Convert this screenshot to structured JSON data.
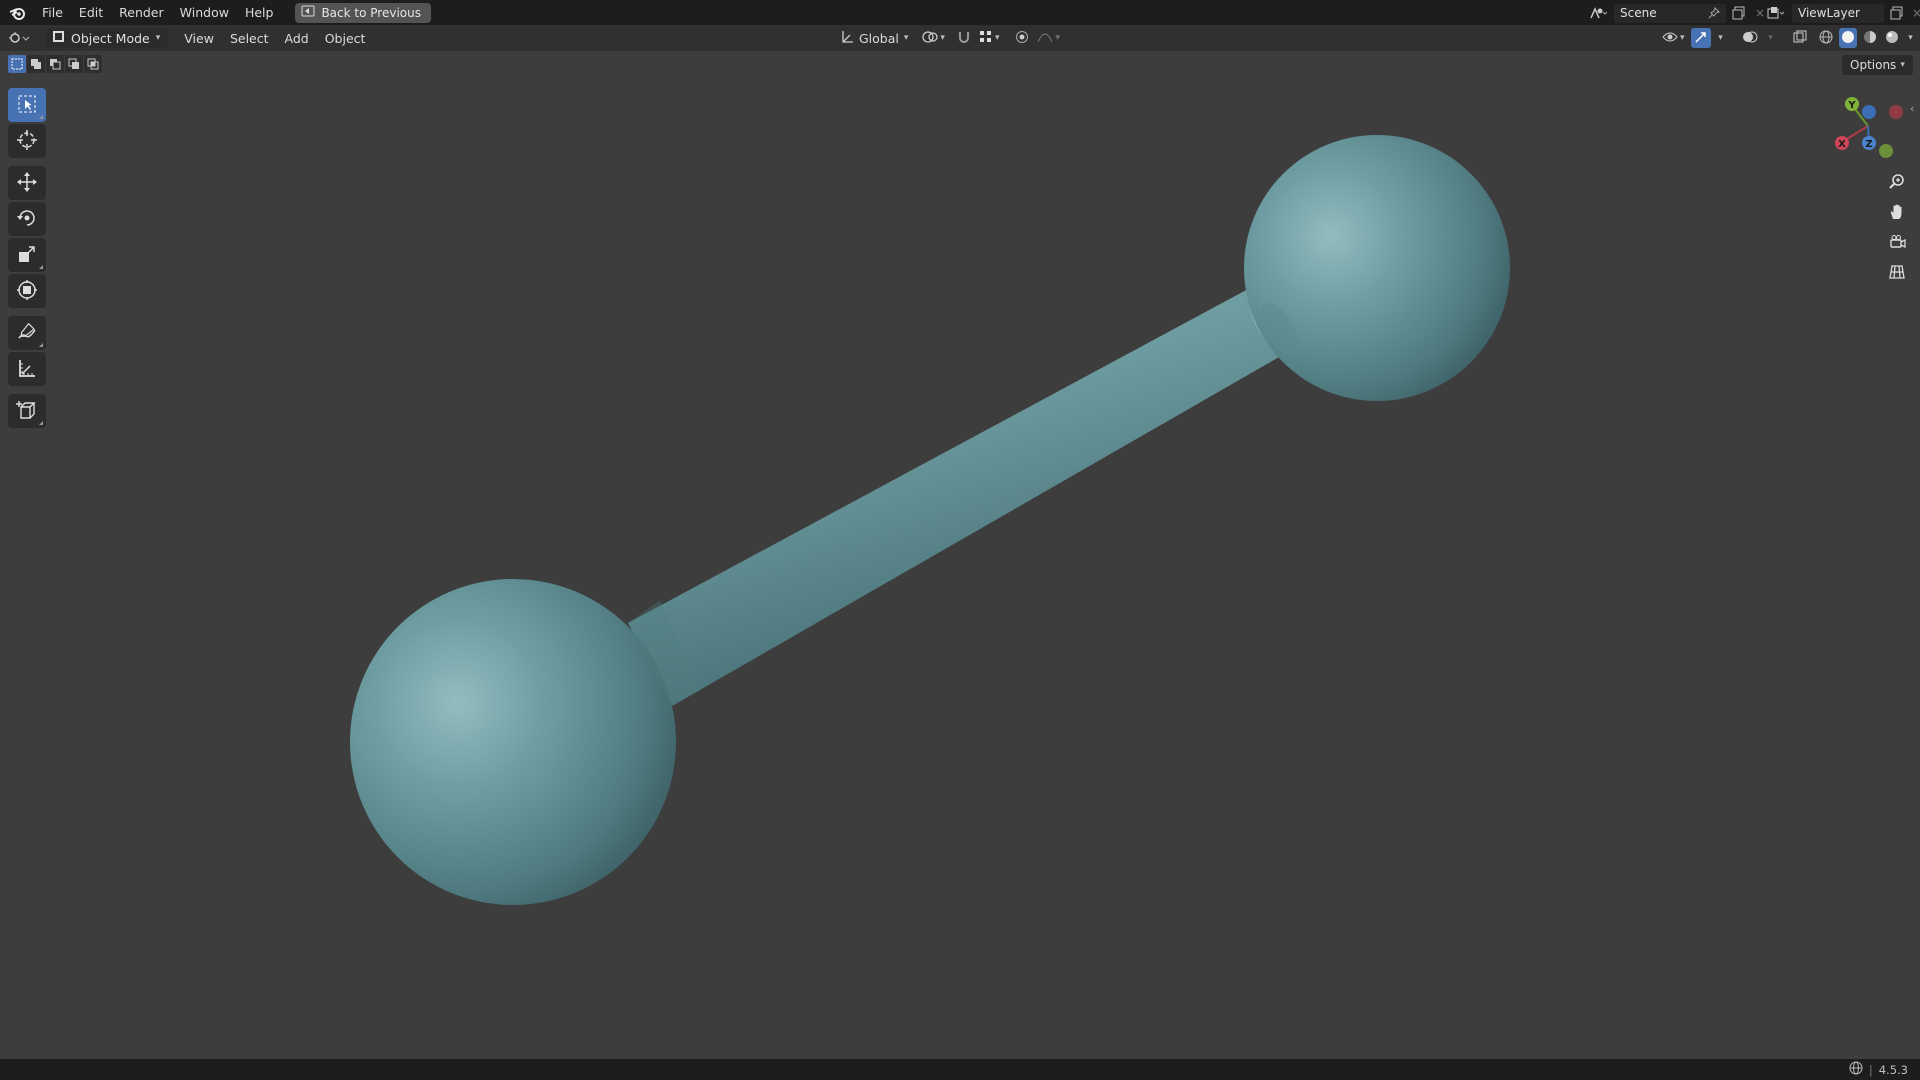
{
  "topbar": {
    "menus": [
      "File",
      "Edit",
      "Render",
      "Window",
      "Help"
    ],
    "back_button_label": "Back to Previous",
    "scene_name": "Scene",
    "view_layer_name": "ViewLayer"
  },
  "header": {
    "mode_label": "Object Mode",
    "menus": [
      "View",
      "Select",
      "Add",
      "Object"
    ],
    "transform_orientation": "Global"
  },
  "viewport": {
    "options_label": "Options",
    "object_color": "#6a9aa0",
    "background_color": "#3d3d3d",
    "gizmo_axes": {
      "x": "X",
      "y": "Y",
      "z": "Z"
    }
  },
  "tools": [
    "select-box",
    "cursor",
    "move",
    "rotate",
    "scale",
    "transform",
    "annotate",
    "measure",
    "add-cube"
  ],
  "statusbar": {
    "version": "4.5.3"
  }
}
